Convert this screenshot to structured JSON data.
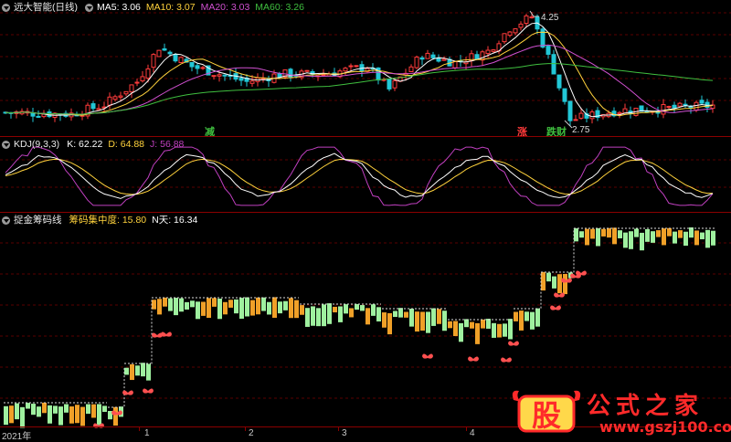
{
  "colors": {
    "background": "#000000",
    "divider": "#8b0000",
    "up": "#ff3b3b",
    "down": "#22c7d6",
    "ma5": "#ffffff",
    "ma10": "#ffd23c",
    "ma20": "#d050d0",
    "ma60": "#3fbf3f",
    "k": "#ffffff",
    "d": "#ffd23c",
    "j": "#c040c0",
    "chip_green": "#9ff09f",
    "chip_orange": "#f0a028",
    "butterfly": "#ff5050"
  },
  "main_panel": {
    "title": "远大智能(日线)",
    "indicators": [
      {
        "label": "MA5:",
        "value": "3.06",
        "color": "#ffffff"
      },
      {
        "label": "MA10:",
        "value": "3.07",
        "color": "#ffd23c"
      },
      {
        "label": "MA20:",
        "value": "3.03",
        "color": "#d050d0"
      },
      {
        "label": "MA60:",
        "value": "3.26",
        "color": "#3fbf3f"
      }
    ],
    "max_price_label": "4.25",
    "min_price_label": "2.75",
    "markers": [
      {
        "text": "减",
        "color": "#3fbf3f"
      },
      {
        "text": "涨",
        "color": "#ff3b3b"
      },
      {
        "text": "跌",
        "color": "#3fbf3f"
      },
      {
        "text": "财",
        "color": "#3fbf3f"
      }
    ]
  },
  "kdj_panel": {
    "title": "KDJ(9,3,3)",
    "indicators": [
      {
        "label": "K:",
        "value": "62.22",
        "color": "#ffffff"
      },
      {
        "label": "D:",
        "value": "64.88",
        "color": "#ffd23c"
      },
      {
        "label": "J:",
        "value": "56.88",
        "color": "#c040c0"
      }
    ]
  },
  "chip_panel": {
    "title": "捉金筹码线",
    "indicators": [
      {
        "label": "筹码集中度:",
        "value": "15.80",
        "color": "#ffd23c"
      },
      {
        "label": "N天:",
        "value": "16.34",
        "color": "#ffffff"
      }
    ]
  },
  "time_axis": {
    "labels": [
      "2021年",
      "1",
      "2",
      "3",
      "4"
    ]
  },
  "watermark": {
    "logo_text": "股",
    "title": "公式之家",
    "url": "www.gszj100.com"
  }
}
